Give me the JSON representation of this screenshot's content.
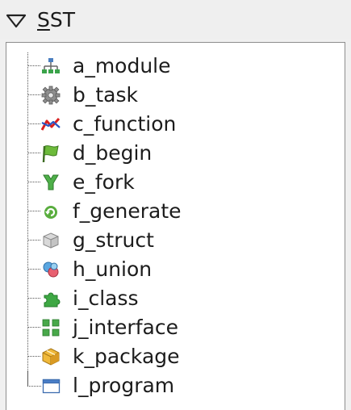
{
  "header": {
    "title_mnemonic": "S",
    "title_rest": "ST",
    "toggle_icon": "chevron-down-icon"
  },
  "tree": {
    "items": [
      {
        "label": "a_module",
        "icon": "hierarchy-icon"
      },
      {
        "label": "b_task",
        "icon": "gear-icon"
      },
      {
        "label": "c_function",
        "icon": "function-graph-icon"
      },
      {
        "label": "d_begin",
        "icon": "flag-icon"
      },
      {
        "label": "e_fork",
        "icon": "fork-icon"
      },
      {
        "label": "f_generate",
        "icon": "generate-icon"
      },
      {
        "label": "g_struct",
        "icon": "cube-stack-icon"
      },
      {
        "label": "h_union",
        "icon": "union-blocks-icon"
      },
      {
        "label": "i_class",
        "icon": "puzzle-icon"
      },
      {
        "label": "j_interface",
        "icon": "interface-squares-icon"
      },
      {
        "label": "k_package",
        "icon": "package-icon"
      },
      {
        "label": "l_program",
        "icon": "window-icon"
      }
    ]
  }
}
